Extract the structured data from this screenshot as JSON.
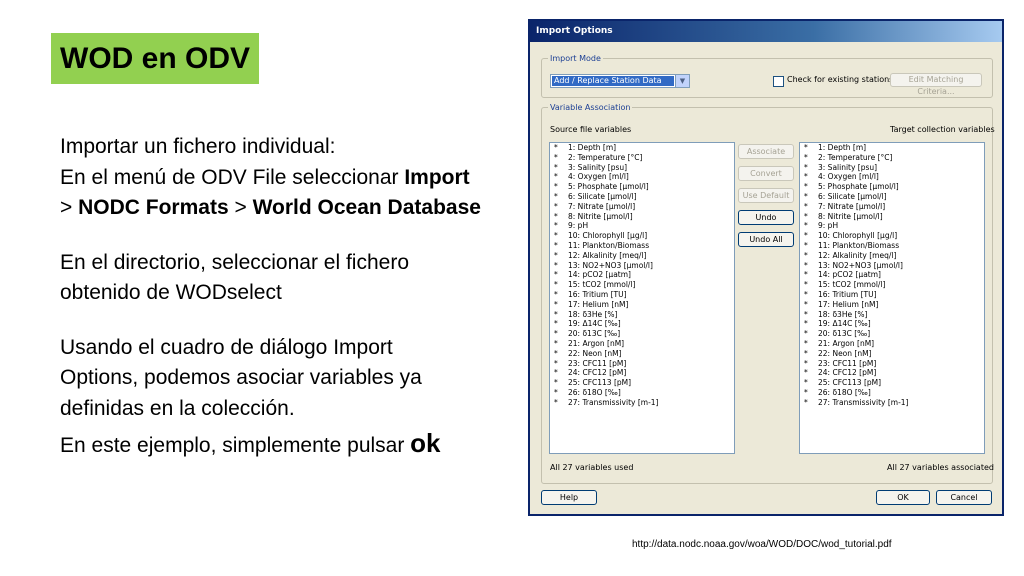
{
  "slide": {
    "title": "WOD en ODV",
    "para1_line1": "Importar un fichero individual:",
    "para1_line2_pre": "En el menú de ODV File seleccionar ",
    "para1_line2_bold": "Import",
    "para1_line3_gt1": "> ",
    "para1_line3_bold1": "NODC Formats",
    "para1_line3_gt2": " > ",
    "para1_line3_bold2": "World Ocean Database",
    "para2_line1": "En el directorio, seleccionar el fichero",
    "para2_line2": "obtenido de WODselect",
    "para3_line1": "Usando el cuadro de diálogo Import",
    "para3_line2": "Options, podemos asociar variables ya",
    "para3_line3": "definidas en la colección.",
    "para4_pre": "En este ejemplo, simplemente pulsar ",
    "para4_ok": "ok",
    "url": "http://data.nodc.noaa.gov/woa/WOD/DOC/wod_tutorial.pdf"
  },
  "dialog": {
    "title": "Import Options",
    "import_mode": {
      "legend": "Import Mode",
      "selected": "Add / Replace Station Data",
      "check_label": "Check for existing stations",
      "edit_matching": "Edit Matching Criteria..."
    },
    "variable_association": {
      "legend": "Variable Association",
      "source_label": "Source file variables",
      "target_label": "Target collection variables",
      "buttons": {
        "associate": "Associate",
        "convert": "Convert",
        "use_default": "Use Default",
        "undo": "Undo",
        "undo_all": "Undo All"
      },
      "variables": [
        "1: Depth [m]",
        "2: Temperature [°C]",
        "3: Salinity [psu]",
        "4: Oxygen [ml/l]",
        "5: Phosphate [µmol/l]",
        "6: Silicate [µmol/l]",
        "7: Nitrate [µmol/l]",
        "8: Nitrite [µmol/l]",
        "9: pH",
        "10: Chlorophyll [µg/l]",
        "11: Plankton/Biomass",
        "12: Alkalinity [meq/l]",
        "13: NO2+NO3 [µmol/l]",
        "14: pCO2 [µatm]",
        "15: tCO2 [mmol/l]",
        "16: Tritium [TU]",
        "17: Helium [nM]",
        "18: δ3He [%]",
        "19: Δ14C [‰]",
        "20: δ13C [‰]",
        "21: Argon [nM]",
        "22: Neon [nM]",
        "23: CFC11 [pM]",
        "24: CFC12 [pM]",
        "25: CFC113 [pM]",
        "26: δ18O [‰]",
        "27: Transmissivity [m-1]"
      ],
      "source_status": "All 27 variables used",
      "target_status": "All 27 variables associated"
    },
    "help": "Help",
    "ok": "OK",
    "cancel": "Cancel"
  }
}
